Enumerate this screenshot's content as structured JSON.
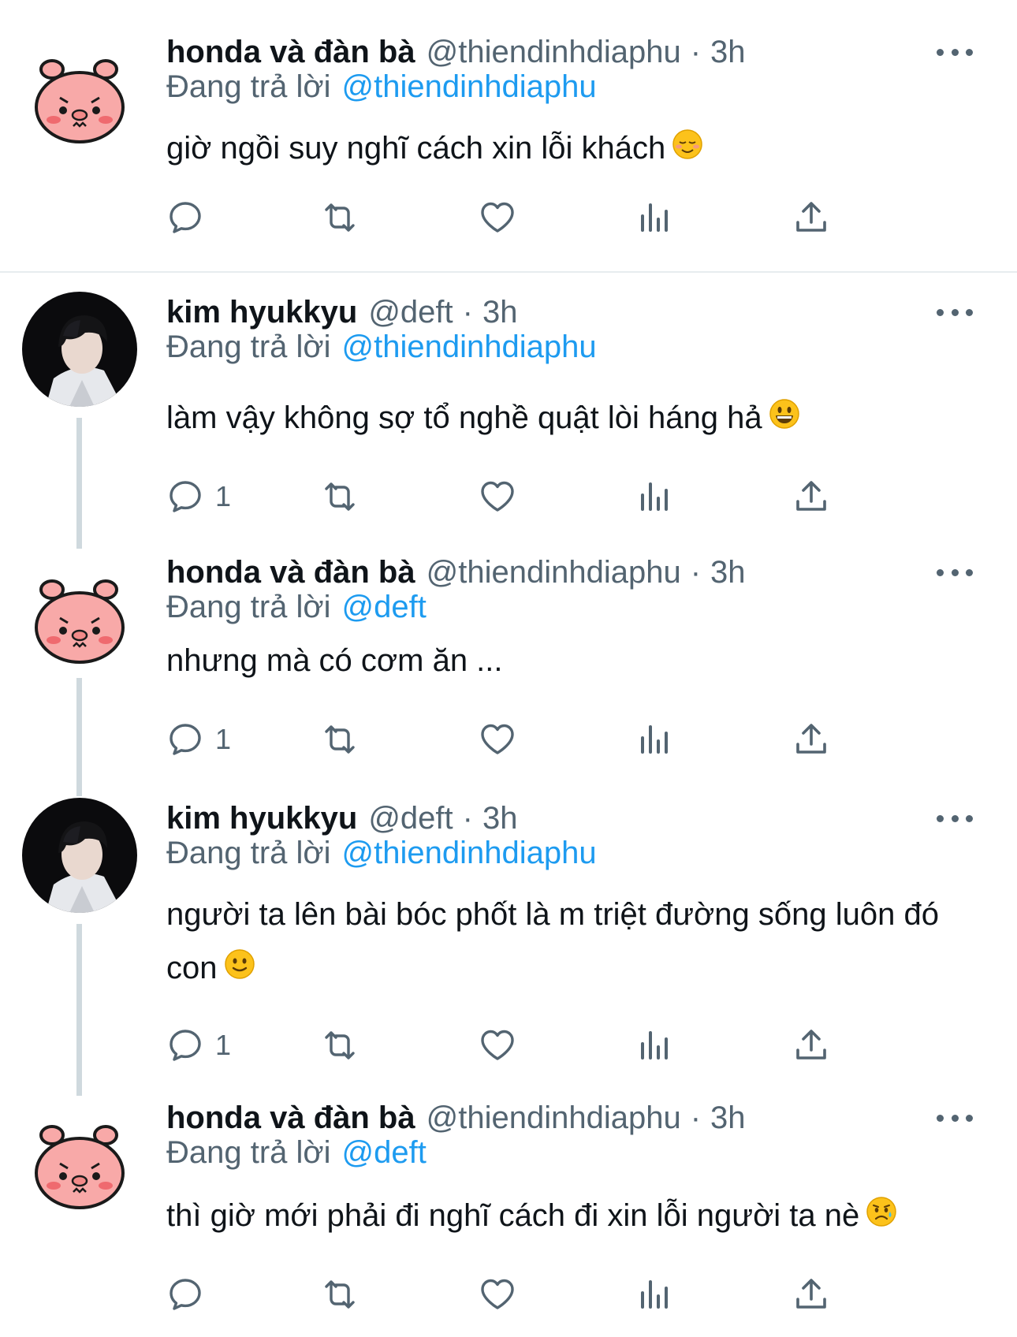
{
  "tweets": [
    {
      "name": "honda và đàn bà",
      "handle": "@thiendinhdiaphu",
      "time": "3h",
      "replying_label": "Đang trả lời",
      "replying_to": "@thiendinhdiaphu",
      "text": "giờ ngồi suy nghĩ cách xin lỗi khách",
      "emoji": "relieved-face",
      "reply_count": ""
    },
    {
      "name": "kim hyukkyu",
      "handle": "@deft",
      "time": "3h",
      "replying_label": "Đang trả lời",
      "replying_to": "@thiendinhdiaphu",
      "text": "làm vậy không sợ tổ nghề quật lòi háng hả",
      "emoji": "grinning-face",
      "reply_count": "1"
    },
    {
      "name": "honda và đàn bà",
      "handle": "@thiendinhdiaphu",
      "time": "3h",
      "replying_label": "Đang trả lời",
      "replying_to": "@deft",
      "text": "nhưng mà có cơm ăn ...",
      "emoji": "",
      "reply_count": "1"
    },
    {
      "name": "kim hyukkyu",
      "handle": "@deft",
      "time": "3h",
      "replying_label": "Đang trả lời",
      "replying_to": "@thiendinhdiaphu",
      "text": "người ta lên bài bóc phốt là m triệt đường sống luôn đó con",
      "emoji": "slightly-smiling-face",
      "reply_count": "1"
    },
    {
      "name": "honda và đàn bà",
      "handle": "@thiendinhdiaphu",
      "time": "3h",
      "replying_label": "Đang trả lời",
      "replying_to": "@deft",
      "text": "thì giờ mới phải đi nghĩ cách đi xin lỗi người ta nè",
      "emoji": "sad-but-relieved-face",
      "reply_count": ""
    }
  ],
  "colors": {
    "link": "#1d9bf0",
    "secondary_text": "#536471",
    "thread_line": "#cfd9de",
    "pig_avatar": "#f8a9a8"
  },
  "icons": [
    "reply-icon",
    "retweet-icon",
    "like-icon",
    "analytics-icon",
    "share-icon",
    "more-icon"
  ]
}
